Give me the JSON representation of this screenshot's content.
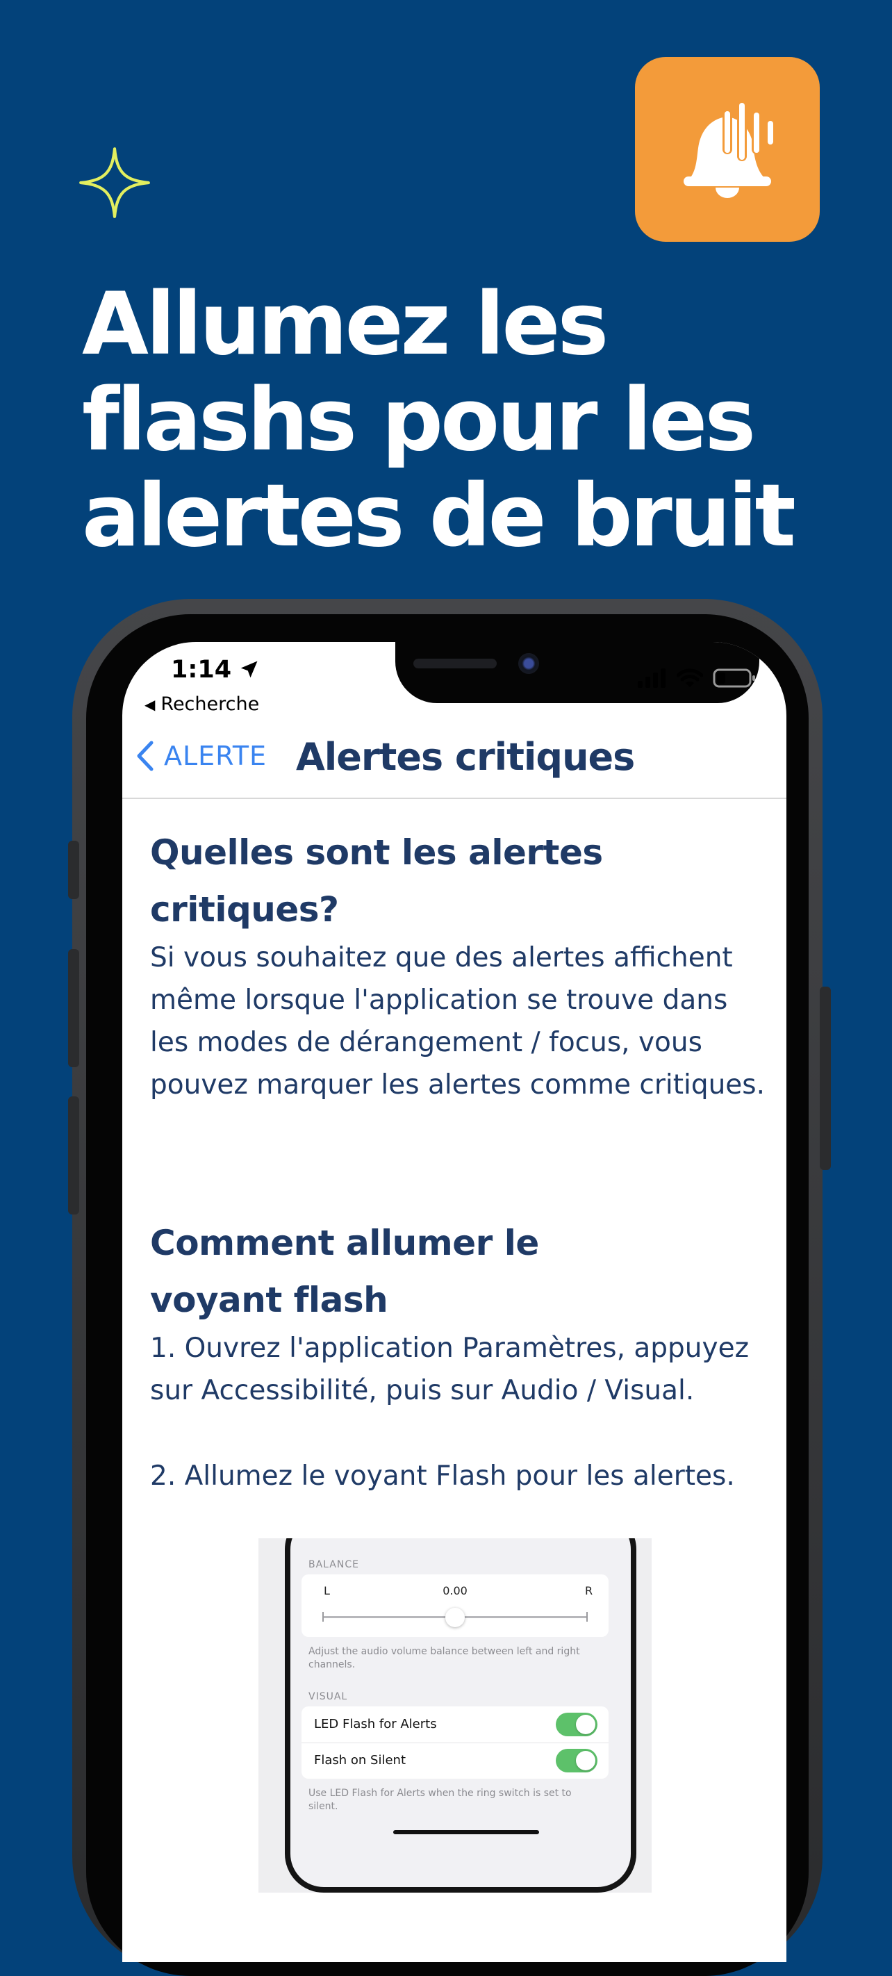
{
  "colors": {
    "background": "#03427a",
    "accent_orange": "#f39b3a",
    "sparkle": "#e3ef5f",
    "heading_text": "#1f3a66",
    "link_blue": "#3a84f0",
    "toggle_green": "#5dc16a"
  },
  "header": {
    "headline": "Allumez les flashs pour les alertes de bruit",
    "sparkle_icon": "sparkle-icon",
    "app_icon": "bell-sound-icon"
  },
  "status_bar": {
    "time": "1:14",
    "location_icon": "location-arrow-icon",
    "back_app": "Recherche",
    "icons": [
      "cellular-signal-icon",
      "wifi-icon",
      "battery-icon"
    ]
  },
  "nav": {
    "back_label": "ALERTE",
    "title": "Alertes critiques"
  },
  "content": {
    "section1": {
      "title": "Quelles sont les alertes critiques?",
      "body": "Si vous souhaitez que des alertes affichent même lorsque l'application se trouve dans les modes de dérangement / focus, vous pouvez marquer les alertes comme critiques."
    },
    "section2": {
      "title": "Comment allumer le voyant flash",
      "step1": "1. Ouvrez l'application Paramètres, appuyez sur Accessibilité, puis sur Audio / Visual.",
      "step2": "2. Allumez le voyant Flash pour les alertes."
    }
  },
  "settings_screenshot": {
    "balance_header": "BALANCE",
    "left_label": "L",
    "right_label": "R",
    "balance_value": "0.00",
    "balance_level": 0.5,
    "balance_note": "Adjust the audio volume balance between left and right channels.",
    "visual_header": "VISUAL",
    "rows": [
      {
        "label": "LED Flash for Alerts",
        "on": true
      },
      {
        "label": "Flash on Silent",
        "on": true
      }
    ],
    "footer_note": "Use LED Flash for Alerts when the ring switch is set to silent."
  }
}
